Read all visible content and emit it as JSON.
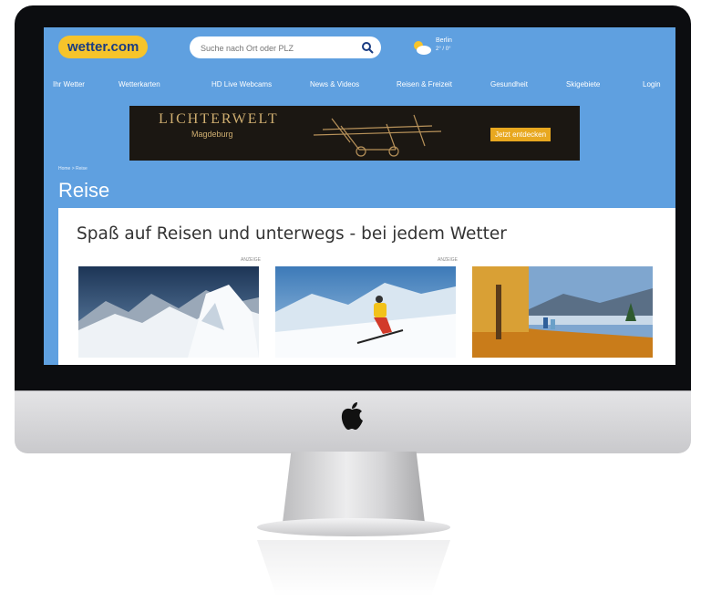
{
  "header": {
    "logo_text": "wetter.com",
    "search_placeholder": "Suche nach Ort oder PLZ",
    "weather_city": "Berlin",
    "weather_temp": "2° / 0°"
  },
  "nav": {
    "items": [
      {
        "label": "Ihr Wetter"
      },
      {
        "label": "Wetterkarten"
      },
      {
        "label": "HD Live Webcams"
      },
      {
        "label": "News & Videos"
      },
      {
        "label": "Reisen & Freizeit"
      },
      {
        "label": "Gesundheit"
      },
      {
        "label": "Skigebiete"
      },
      {
        "label": "Login"
      }
    ]
  },
  "ad": {
    "title": "LICHTERWELT",
    "subtitle": "Magdeburg",
    "cta": "Jetzt entdecken"
  },
  "breadcrumb": "Home > Reise",
  "page_title": "Reise",
  "main": {
    "headline": "Spaß auf Reisen und unterwegs - bei jedem Wetter",
    "cards": [
      {
        "label": "ANZEIGE",
        "image": "snowy-mountains"
      },
      {
        "label": "ANZEIGE",
        "image": "skier"
      },
      {
        "label": "",
        "image": "autumn-hikers"
      }
    ]
  },
  "colors": {
    "accent_blue": "#5fa0e0",
    "logo_yellow": "#f6c42b",
    "logo_text": "#1a3c82",
    "ad_gold": "#cfae70",
    "cta_orange": "#e8a820"
  }
}
